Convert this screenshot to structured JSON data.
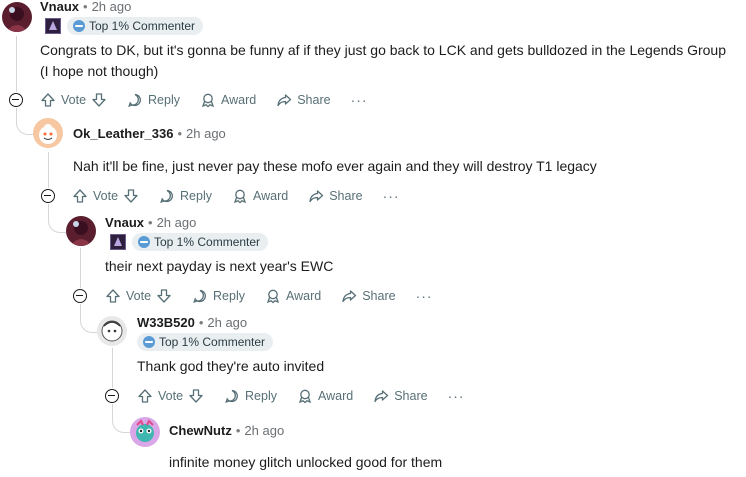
{
  "colors": {
    "text": "#1c1c1c",
    "muted": "#576f76",
    "badge_bg": "#e9eef1",
    "thread": "#d4d7d9"
  },
  "actions": {
    "vote": "Vote",
    "reply": "Reply",
    "award": "Award",
    "share": "Share",
    "more": "···"
  },
  "comments": [
    {
      "author": "Vnaux",
      "time": "2h ago",
      "badge": "Top 1% Commenter",
      "text_line1": "Congrats to DK, but it's gonna be funny af if they just go back to LCK and gets bulldozed in the Legends Group",
      "text_line2": "(I hope not though)"
    },
    {
      "author": "Ok_Leather_336",
      "time": "2h ago",
      "text": "Nah it'll be fine, just never pay these mofo ever again and they will destroy T1 legacy"
    },
    {
      "author": "Vnaux",
      "time": "2h ago",
      "badge": "Top 1% Commenter",
      "text": "their next payday is next year's EWC"
    },
    {
      "author": "W33B520",
      "time": "2h ago",
      "badge": "Top 1% Commenter",
      "text": "Thank god they're auto invited"
    },
    {
      "author": "ChewNutz",
      "time": "2h ago",
      "text": "infinite money glitch unlocked good for them"
    }
  ]
}
